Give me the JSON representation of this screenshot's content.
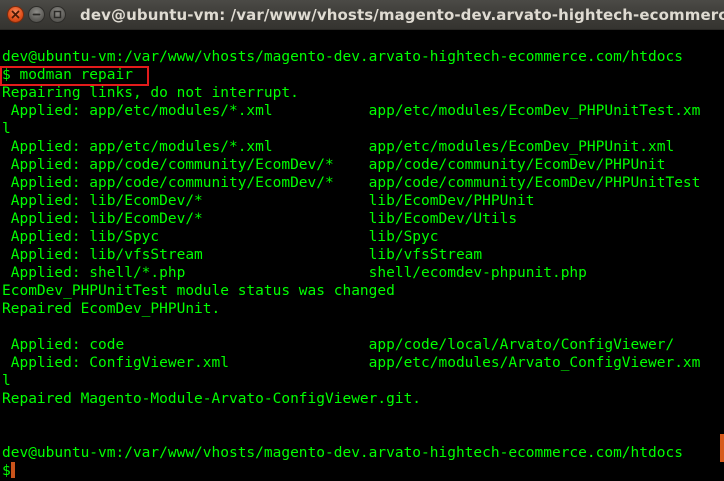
{
  "window": {
    "title": "dev@ubuntu-vm: /var/www/vhosts/magento-dev.arvato-hightech-ecommerce.com/htdocs"
  },
  "controls": {
    "close_icon": "close-icon",
    "minimize_icon": "minimize-icon",
    "maximize_icon": "maximize-icon"
  },
  "colors": {
    "terminal_text": "#00ff00",
    "background": "#000000",
    "highlight": "#e21b1b",
    "close_button": "#e2521d"
  },
  "terminal": {
    "lines": [
      "dev@ubuntu-vm:/var/www/vhosts/magento-dev.arvato-hightech-ecommerce.com/htdocs",
      "$ modman repair",
      "Repairing links, do not interrupt.",
      " Applied: app/etc/modules/*.xml           app/etc/modules/EcomDev_PHPUnitTest.xm",
      "l",
      " Applied: app/etc/modules/*.xml           app/etc/modules/EcomDev_PHPUnit.xml",
      " Applied: app/code/community/EcomDev/*    app/code/community/EcomDev/PHPUnit",
      " Applied: app/code/community/EcomDev/*    app/code/community/EcomDev/PHPUnitTest",
      " Applied: lib/EcomDev/*                   lib/EcomDev/PHPUnit",
      " Applied: lib/EcomDev/*                   lib/EcomDev/Utils",
      " Applied: lib/Spyc                        lib/Spyc",
      " Applied: lib/vfsStream                   lib/vfsStream",
      " Applied: shell/*.php                     shell/ecomdev-phpunit.php",
      "EcomDev_PHPUnitTest module status was changed",
      "Repaired EcomDev_PHPUnit.",
      "",
      " Applied: code                            app/code/local/Arvato/ConfigViewer/",
      " Applied: ConfigViewer.xml                app/etc/modules/Arvato_ConfigViewer.xm",
      "l",
      "Repaired Magento-Module-Arvato-ConfigViewer.git.",
      "",
      "",
      "dev@ubuntu-vm:/var/www/vhosts/magento-dev.arvato-hightech-ecommerce.com/htdocs",
      "$"
    ]
  }
}
